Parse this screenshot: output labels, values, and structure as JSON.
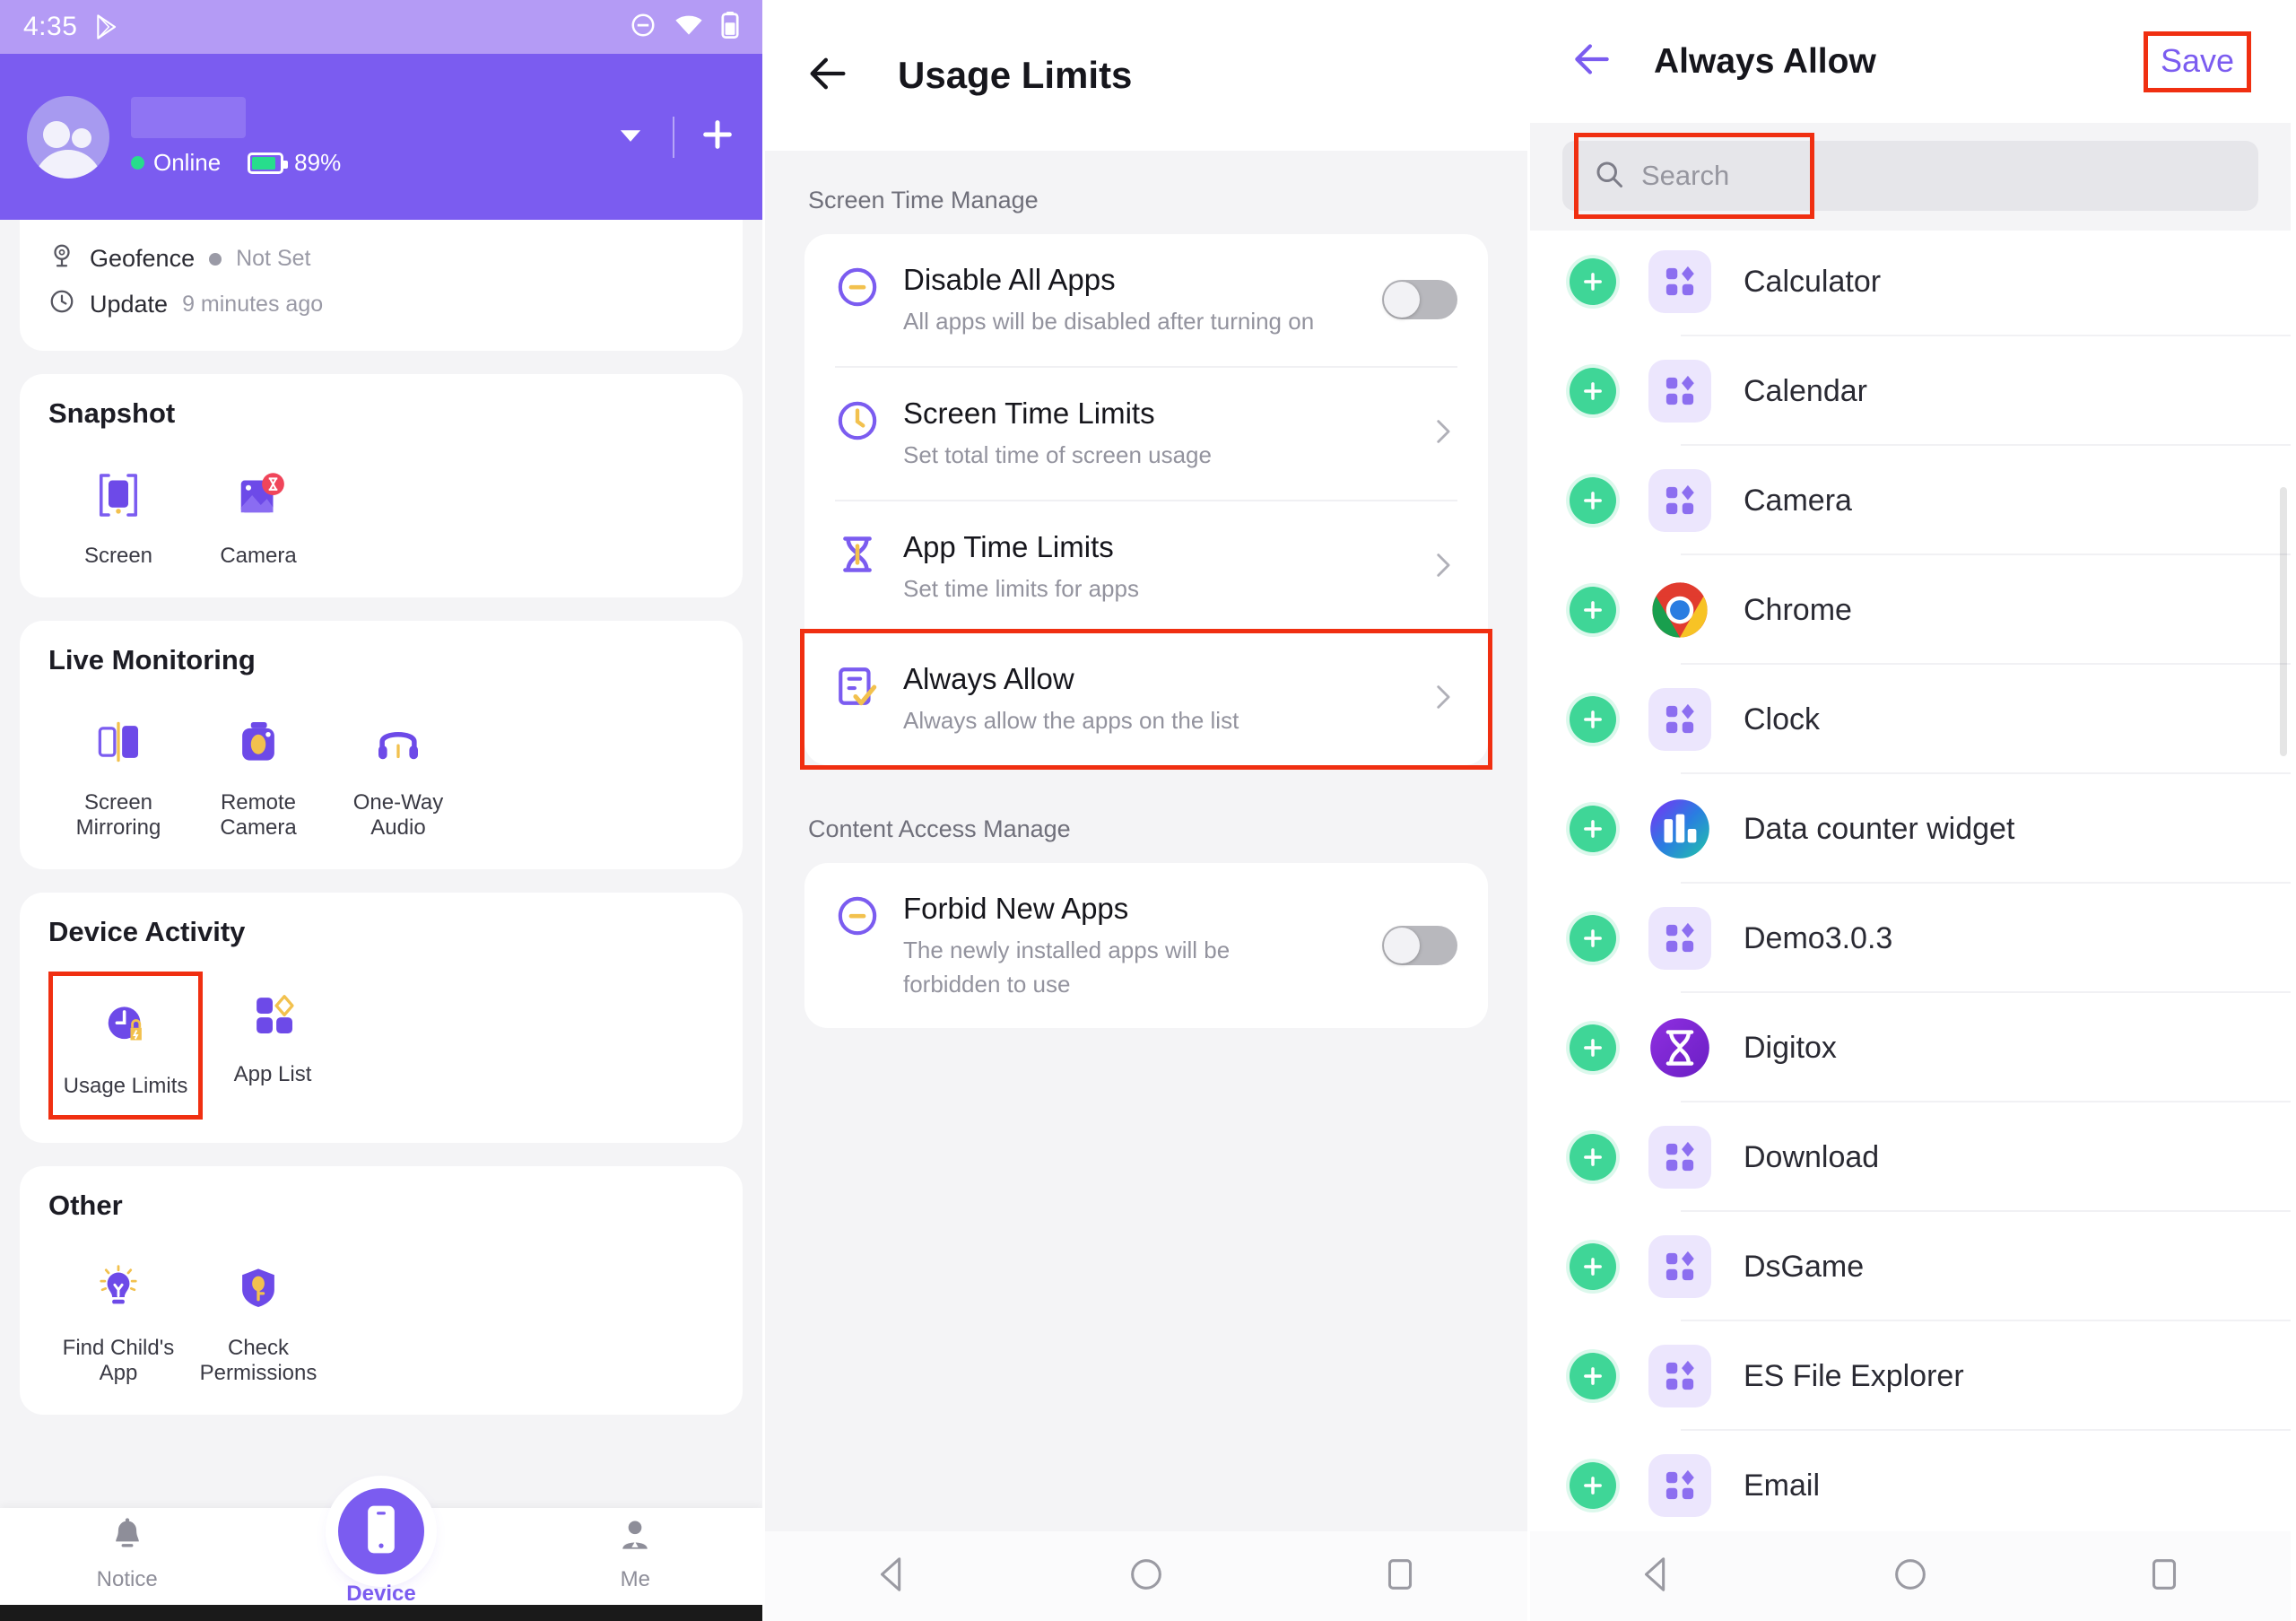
{
  "panel1": {
    "status_bar": {
      "time": "4:35",
      "icons": [
        "play-store-icon",
        "do-not-disturb-icon",
        "wifi-icon",
        "battery-icon"
      ]
    },
    "header": {
      "name_redacted": "",
      "status_text": "Online",
      "battery_percent": "89%",
      "dropdown_icon": "chevron-down-icon",
      "add_icon": "plus-icon"
    },
    "status_card": {
      "geofence_label": "Geofence",
      "geofence_value": "Not Set",
      "update_label": "Update",
      "update_value": "9 minutes ago"
    },
    "sections": [
      {
        "title": "Snapshot",
        "tiles": [
          {
            "label": "Screen",
            "icon": "screen-snapshot-icon",
            "highlighted": false
          },
          {
            "label": "Camera",
            "icon": "camera-snapshot-icon",
            "highlighted": false
          }
        ]
      },
      {
        "title": "Live Monitoring",
        "tiles": [
          {
            "label": "Screen Mirroring",
            "icon": "screen-mirroring-icon",
            "highlighted": false
          },
          {
            "label": "Remote Camera",
            "icon": "remote-camera-icon",
            "highlighted": false
          },
          {
            "label": "One-Way Audio",
            "icon": "one-way-audio-icon",
            "highlighted": false
          }
        ]
      },
      {
        "title": "Device Activity",
        "tiles": [
          {
            "label": "Usage Limits",
            "icon": "usage-limits-icon",
            "highlighted": true
          },
          {
            "label": "App List",
            "icon": "app-list-icon",
            "highlighted": false
          }
        ]
      },
      {
        "title": "Other",
        "tiles": [
          {
            "label": "Find Child's App",
            "icon": "lightbulb-icon",
            "highlighted": false
          },
          {
            "label": "Check Permissions",
            "icon": "shield-key-icon",
            "highlighted": false
          }
        ]
      }
    ],
    "bottom_nav": [
      {
        "label": "Notice",
        "icon": "bell-icon",
        "active": false
      },
      {
        "label": "Device",
        "icon": "phone-icon",
        "active": true
      },
      {
        "label": "Me",
        "icon": "person-icon",
        "active": false
      }
    ]
  },
  "panel2": {
    "app_bar": {
      "back_icon": "back-arrow-icon",
      "title": "Usage Limits"
    },
    "section1_label": "Screen Time Manage",
    "section1_items": [
      {
        "title": "Disable All Apps",
        "subtitle": "All apps will be disabled after turning on",
        "icon": "minus-circle-icon",
        "control": "toggle",
        "toggle_on": false,
        "highlighted": false
      },
      {
        "title": "Screen Time Limits",
        "subtitle": "Set total time of screen usage",
        "icon": "clock-icon",
        "control": "chevron",
        "highlighted": false
      },
      {
        "title": "App Time Limits",
        "subtitle": "Set time limits for apps",
        "icon": "hourglass-icon",
        "control": "chevron",
        "highlighted": false
      },
      {
        "title": "Always Allow",
        "subtitle": "Always allow the apps on the list",
        "icon": "allow-list-icon",
        "control": "chevron",
        "highlighted": true
      }
    ],
    "section2_label": "Content Access Manage",
    "section2_items": [
      {
        "title": "Forbid New Apps",
        "subtitle": "The newly installed apps will be forbidden to use",
        "icon": "minus-circle-icon",
        "control": "toggle",
        "toggle_on": false,
        "highlighted": false
      }
    ],
    "android_nav": [
      "back-nav-icon",
      "home-nav-icon",
      "recents-nav-icon"
    ]
  },
  "panel3": {
    "app_bar": {
      "back_icon": "back-arrow-icon",
      "title": "Always Allow",
      "save_label": "Save"
    },
    "search": {
      "placeholder": "Search",
      "value": "",
      "icon": "search-icon"
    },
    "apps": [
      {
        "name": "Calculator",
        "icon": "generic-app-icon"
      },
      {
        "name": "Calendar",
        "icon": "generic-app-icon"
      },
      {
        "name": "Camera",
        "icon": "generic-app-icon"
      },
      {
        "name": "Chrome",
        "icon": "chrome-icon"
      },
      {
        "name": "Clock",
        "icon": "generic-app-icon"
      },
      {
        "name": "Data counter widget",
        "icon": "data-counter-icon"
      },
      {
        "name": "Demo3.0.3",
        "icon": "generic-app-icon"
      },
      {
        "name": "Digitox",
        "icon": "digitox-icon"
      },
      {
        "name": "Download",
        "icon": "generic-app-icon"
      },
      {
        "name": "DsGame",
        "icon": "generic-app-icon"
      },
      {
        "name": "ES File Explorer",
        "icon": "generic-app-icon"
      },
      {
        "name": "Email",
        "icon": "generic-app-icon"
      }
    ],
    "add_icon": "plus-icon",
    "android_nav": [
      "back-nav-icon",
      "home-nav-icon",
      "recents-nav-icon"
    ]
  },
  "colors": {
    "brand_purple": "#7b5cf0",
    "accent_yellow": "#f2c14e",
    "highlight_red": "#f02f11",
    "add_green": "#3fd697"
  }
}
